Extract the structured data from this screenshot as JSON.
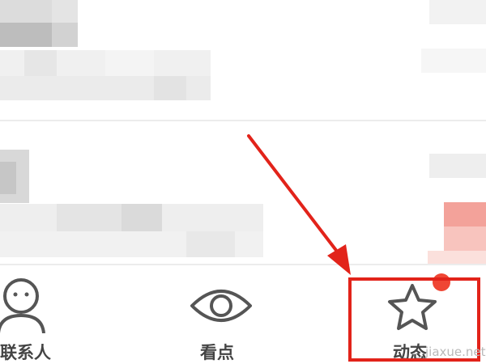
{
  "tabs": [
    {
      "label": "联系人",
      "icon": "contacts-person-icon"
    },
    {
      "label": "看点",
      "icon": "eye-icon"
    },
    {
      "label": "动态",
      "icon": "star-icon"
    }
  ],
  "watermark": "jiaxue.net",
  "colors": {
    "annotation_red": "#e2231a",
    "notification_dot": "#ef4634",
    "icon_stroke": "#555555"
  }
}
